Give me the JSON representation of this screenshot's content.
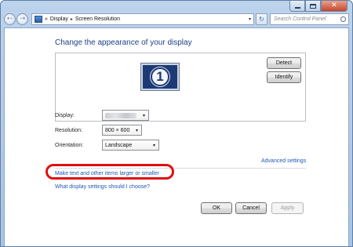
{
  "navigation": {
    "breadcrumbs": [
      "Display",
      "Screen Resolution"
    ],
    "chevron_prefix": "«",
    "search_placeholder": "Search Control Panel"
  },
  "page": {
    "heading": "Change the appearance of your display",
    "monitor_number": "1",
    "detect_label": "Detect",
    "identify_label": "Identify"
  },
  "settings": {
    "display_label": "Display:",
    "resolution_label": "Resolution:",
    "resolution_value": "800 × 600",
    "orientation_label": "Orientation:",
    "orientation_value": "Landscape"
  },
  "links": {
    "advanced": "Advanced settings",
    "text_size": "Make text and other items larger or smaller",
    "help": "What display settings should I choose?"
  },
  "footer": {
    "ok_label": "OK",
    "cancel_label": "Cancel",
    "apply_label": "Apply"
  },
  "colors": {
    "heading": "#1e3f8a",
    "link": "#1f57b4",
    "highlight": "#e01010"
  },
  "icons": [
    "back-arrow-icon",
    "forward-arrow-icon",
    "folder-icon",
    "refresh-icon",
    "search-icon",
    "dropdown-arrow-icon"
  ]
}
